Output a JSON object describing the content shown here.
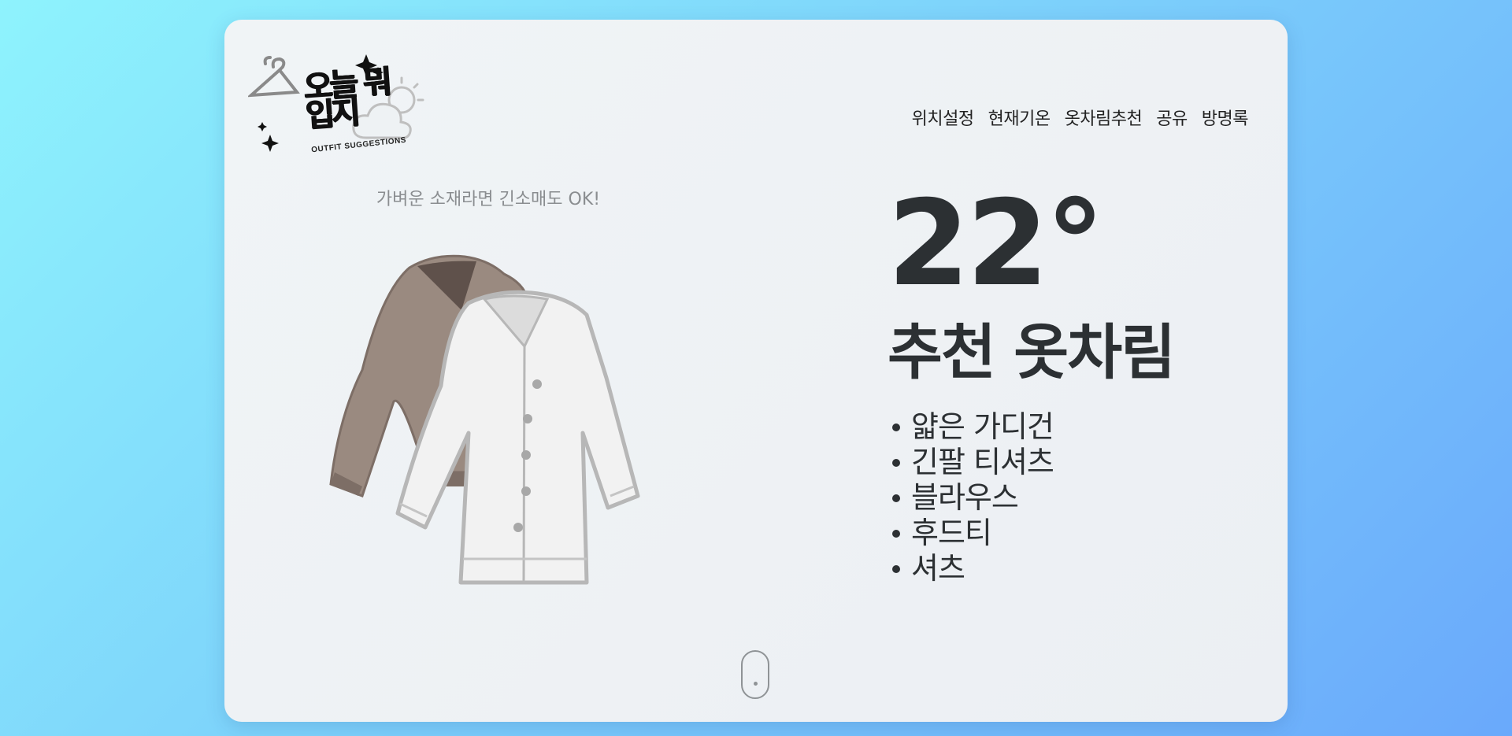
{
  "logo": {
    "title": "오늘 뭐입지",
    "subtitle": "OUTFIT SUGGESTIONS",
    "icons": [
      "hanger-icon",
      "sparkle-icon",
      "sun-cloud-icon"
    ]
  },
  "nav": {
    "items": [
      {
        "label": "위치설정"
      },
      {
        "label": "현재기온"
      },
      {
        "label": "옷차림추천"
      },
      {
        "label": "공유"
      },
      {
        "label": "방명록"
      }
    ]
  },
  "outfit": {
    "caption": "가벼운 소재라면 긴소매도 OK!",
    "image": "cardigans-illustration"
  },
  "weather": {
    "temperature": "22°",
    "recommend_title": "추천 옷차림",
    "items": [
      "얇은 가디건",
      "긴팔 티셔츠",
      "블라우스",
      "후드티",
      "셔츠"
    ]
  },
  "scroll": {
    "icon": "mouse-scroll-icon"
  },
  "colors": {
    "background_start": "#8ef3fd",
    "background_end": "#6aa9fb",
    "card": "#eef2f4",
    "text_dark": "#2c3033",
    "text_muted": "#8a8d90",
    "cardigan_brown": "#9a8a80",
    "cardigan_white": "#f2f2f2"
  }
}
